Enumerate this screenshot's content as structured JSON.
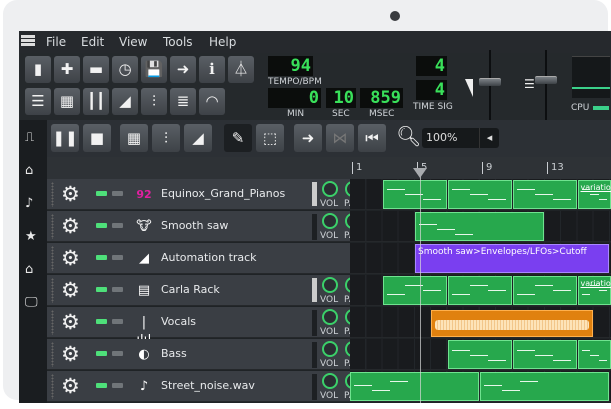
{
  "menu": {
    "items": [
      "File",
      "Edit",
      "View",
      "Tools",
      "Help"
    ]
  },
  "toolbar": {
    "row1": [
      "new-file",
      "new-from-template",
      "open",
      "recent",
      "save",
      "export",
      "info",
      "metronome"
    ],
    "row1_glyphs": [
      "▮",
      "✚",
      "▬",
      "◷",
      "💾",
      "➜",
      "ℹ",
      "⏃"
    ],
    "row2": [
      "song-editor",
      "pattern-editor",
      "piano-roll",
      "automation-editor",
      "mixer",
      "project-notes",
      "controller-rack"
    ],
    "row2_glyphs": [
      "☰",
      "▦",
      "┃┃",
      "◢",
      "⫶",
      "≣",
      "◠"
    ],
    "tempo": "94",
    "tempo_label": "TEMPO/BPM",
    "min": "0",
    "sec": "10",
    "msec": "859",
    "min_label": "MIN",
    "sec_label": "SEC",
    "msec_label": "MSEC",
    "timesig_num": "4",
    "timesig_den": "4",
    "timesig_label": "TIME SIG",
    "cpu_label": "CPU"
  },
  "song_toolbar": {
    "buttons": [
      "pause",
      "stop",
      "add-pattern",
      "add-sample-track",
      "add-automation-track",
      "draw-mode",
      "select-mode",
      "follow-playhead",
      "loop-points",
      "back-to-start"
    ],
    "glyphs": [
      "❚❚",
      "■",
      "▦",
      "⫶",
      "◢",
      "✎",
      "⬚",
      "➜",
      "⋈",
      "⏮"
    ],
    "zoom": "100%"
  },
  "ruler": {
    "labels": [
      "1",
      "5",
      "9",
      "13"
    ]
  },
  "colors": {
    "pattern": "#27a84d",
    "automation": "#7a3ff0",
    "audio": "#e0810f",
    "led_on": "#4ee07a"
  },
  "tracks": [
    {
      "name": "Equinox_Grand_Pianos",
      "icon": "equinox-icon",
      "glyph": "92",
      "vol": 0.75,
      "clips": [
        {
          "start": 3,
          "length": 4
        },
        {
          "start": 7,
          "length": 4
        },
        {
          "start": 11,
          "length": 4
        },
        {
          "start": 15,
          "length": 4,
          "label": "variation"
        }
      ]
    },
    {
      "name": "Smooth saw",
      "icon": "tripleoscillator-icon",
      "glyph": "🐮",
      "vol": 0.3,
      "clips": [
        {
          "start": 5,
          "length": 8
        }
      ]
    },
    {
      "name": "Automation track",
      "icon": "automation-icon",
      "glyph": "◢",
      "type": "automation",
      "clips": [
        {
          "start": 5,
          "length": 12,
          "label": "Smooth saw>Envelopes/LFOs>Cutoff"
        }
      ]
    },
    {
      "name": "Carla Rack",
      "icon": "carla-icon",
      "glyph": "▤",
      "vol": 0.2,
      "clips": [
        {
          "start": 3,
          "length": 4
        },
        {
          "start": 7,
          "length": 4
        },
        {
          "start": 11,
          "length": 4
        },
        {
          "start": 15,
          "length": 4,
          "label": "variation"
        }
      ]
    },
    {
      "name": "Vocals",
      "icon": "waveform-icon",
      "glyph": "|ılı|",
      "vol": 0.5,
      "type": "audio",
      "clips": [
        {
          "start": 6,
          "length": 10
        }
      ]
    },
    {
      "name": "Bass",
      "icon": "kicker-icon",
      "glyph": "◐",
      "vol": 0.3,
      "clips": [
        {
          "start": 7,
          "length": 4
        },
        {
          "start": 11,
          "length": 4
        },
        {
          "start": 15,
          "length": 4
        }
      ]
    },
    {
      "name": "Street_noise.wav",
      "icon": "music-note-icon",
      "glyph": "♪",
      "vol": 0.3,
      "clips": [
        {
          "start": 1,
          "length": 8
        },
        {
          "start": 9,
          "length": 8
        }
      ]
    }
  ],
  "knob_labels": {
    "vol": "VOL",
    "pan": "PAN"
  }
}
